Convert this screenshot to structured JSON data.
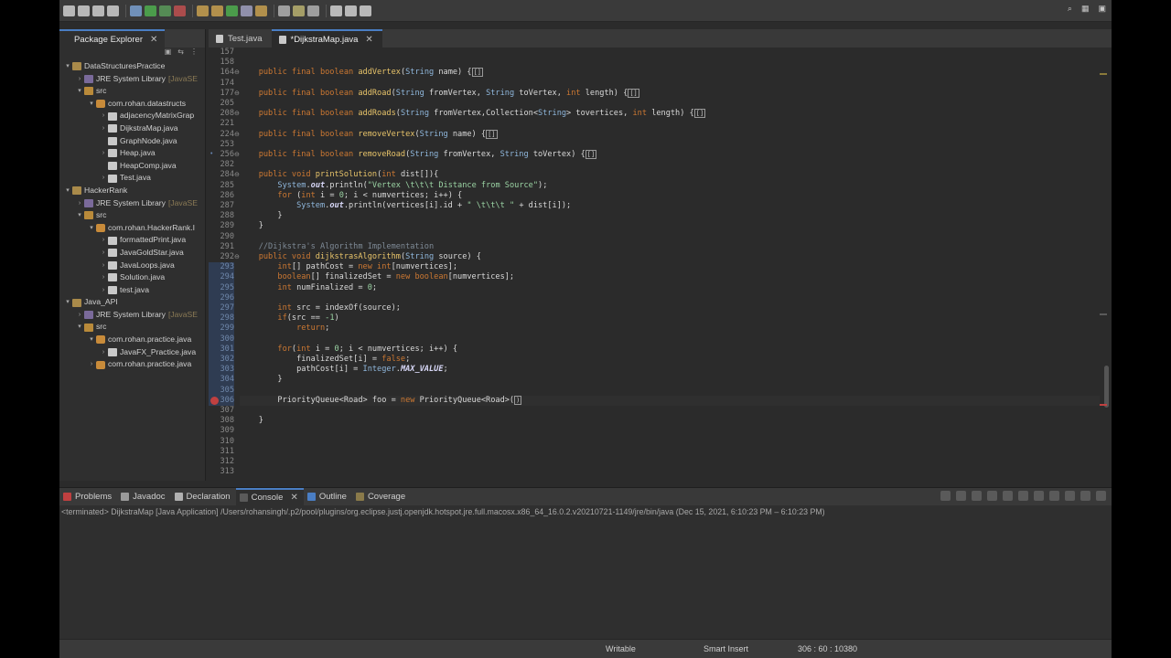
{
  "colors": {
    "accent": "#4a7ec4",
    "error": "#c04040",
    "editor_bg": "#2b2b2b"
  },
  "toolbar": {
    "icons": [
      "new-icon",
      "save-icon",
      "save-all-icon",
      "print-icon",
      "debug-icon",
      "run-icon",
      "coverage-icon",
      "external-tools-icon",
      "new-java-project-icon",
      "new-package-icon",
      "new-class-icon",
      "open-type-icon",
      "search-icon",
      "toggle-mark-icon",
      "annotation-icon",
      "prev-annotation-icon",
      "back-icon",
      "forward-icon",
      "perspective-icon"
    ],
    "right_icons": [
      "search-icon",
      "java-perspective-icon",
      "debug-perspective-icon"
    ]
  },
  "package_explorer": {
    "title": "Package Explorer",
    "tree": [
      {
        "indent": 0,
        "twisty": "v",
        "icon": "project",
        "label": "DataStructuresPractice"
      },
      {
        "indent": 1,
        "twisty": ">",
        "icon": "lib",
        "label": "JRE System Library",
        "extra": "[JavaSE"
      },
      {
        "indent": 1,
        "twisty": "v",
        "icon": "src",
        "label": "src"
      },
      {
        "indent": 2,
        "twisty": "v",
        "icon": "pkg",
        "label": "com.rohan.datastructs"
      },
      {
        "indent": 3,
        "twisty": ">",
        "icon": "java",
        "label": "adjacencyMatrixGrap"
      },
      {
        "indent": 3,
        "twisty": ">",
        "icon": "java",
        "label": "DijkstraMap.java"
      },
      {
        "indent": 3,
        "twisty": "",
        "icon": "java",
        "label": "GraphNode.java"
      },
      {
        "indent": 3,
        "twisty": ">",
        "icon": "java",
        "label": "Heap.java"
      },
      {
        "indent": 3,
        "twisty": "",
        "icon": "java",
        "label": "HeapComp.java"
      },
      {
        "indent": 3,
        "twisty": ">",
        "icon": "java",
        "label": "Test.java"
      },
      {
        "indent": 0,
        "twisty": "v",
        "icon": "project",
        "label": "HackerRank"
      },
      {
        "indent": 1,
        "twisty": ">",
        "icon": "lib",
        "label": "JRE System Library",
        "extra": "[JavaSE"
      },
      {
        "indent": 1,
        "twisty": "v",
        "icon": "src",
        "label": "src"
      },
      {
        "indent": 2,
        "twisty": "v",
        "icon": "pkg",
        "label": "com.rohan.HackerRank.I"
      },
      {
        "indent": 3,
        "twisty": ">",
        "icon": "java",
        "label": "formattedPrint.java"
      },
      {
        "indent": 3,
        "twisty": ">",
        "icon": "java",
        "label": "JavaGoldStar.java"
      },
      {
        "indent": 3,
        "twisty": ">",
        "icon": "java",
        "label": "JavaLoops.java"
      },
      {
        "indent": 3,
        "twisty": ">",
        "icon": "java",
        "label": "Solution.java"
      },
      {
        "indent": 3,
        "twisty": ">",
        "icon": "java",
        "label": "test.java"
      },
      {
        "indent": 0,
        "twisty": "v",
        "icon": "project",
        "label": "Java_API"
      },
      {
        "indent": 1,
        "twisty": ">",
        "icon": "lib",
        "label": "JRE System Library",
        "extra": "[JavaSE"
      },
      {
        "indent": 1,
        "twisty": "v",
        "icon": "src",
        "label": "src"
      },
      {
        "indent": 2,
        "twisty": "v",
        "icon": "pkg",
        "label": "com.rohan.practice.java"
      },
      {
        "indent": 3,
        "twisty": ">",
        "icon": "java",
        "label": "JavaFX_Practice.java"
      },
      {
        "indent": 2,
        "twisty": ">",
        "icon": "pkg",
        "label": "com.rohan.practice.java"
      }
    ]
  },
  "editor": {
    "tabs": [
      {
        "label": "Test.java",
        "active": false
      },
      {
        "label": "*DijkstraMap.java",
        "active": true
      }
    ],
    "lines": [
      {
        "n": "157",
        "segs": []
      },
      {
        "n": "158",
        "segs": []
      },
      {
        "n": "164",
        "fold": true,
        "segs": [
          [
            "kw",
            "    public final boolean "
          ],
          [
            "fn",
            "addVertex"
          ],
          [
            "pl",
            "("
          ],
          [
            "ty",
            "String"
          ],
          [
            "pl",
            " name) {"
          ],
          [
            "box",
            "[]"
          ]
        ]
      },
      {
        "n": "174",
        "segs": []
      },
      {
        "n": "177",
        "fold": true,
        "segs": [
          [
            "kw",
            "    public final boolean "
          ],
          [
            "fn",
            "addRoad"
          ],
          [
            "pl",
            "("
          ],
          [
            "ty",
            "String"
          ],
          [
            "pl",
            " fromVertex, "
          ],
          [
            "ty",
            "String"
          ],
          [
            "pl",
            " toVertex, "
          ],
          [
            "kw",
            "int"
          ],
          [
            "pl",
            " length) {"
          ],
          [
            "box",
            "[]"
          ]
        ]
      },
      {
        "n": "205",
        "segs": []
      },
      {
        "n": "208",
        "fold": true,
        "segs": [
          [
            "kw",
            "    public final boolean "
          ],
          [
            "fn",
            "addRoads"
          ],
          [
            "pl",
            "("
          ],
          [
            "ty",
            "String"
          ],
          [
            "pl",
            " fromVertex,Collection<"
          ],
          [
            "ty",
            "String"
          ],
          [
            "pl",
            "> tovertices, "
          ],
          [
            "kw",
            "int"
          ],
          [
            "pl",
            " length) {"
          ],
          [
            "box",
            "[]"
          ]
        ]
      },
      {
        "n": "221",
        "segs": []
      },
      {
        "n": "224",
        "fold": true,
        "segs": [
          [
            "kw",
            "    public final boolean "
          ],
          [
            "fn",
            "removeVertex"
          ],
          [
            "pl",
            "("
          ],
          [
            "ty",
            "String"
          ],
          [
            "pl",
            " name) {"
          ],
          [
            "box",
            "[]"
          ]
        ]
      },
      {
        "n": "253",
        "segs": []
      },
      {
        "n": "256",
        "fold": true,
        "dot": true,
        "segs": [
          [
            "kw",
            "    public final boolean "
          ],
          [
            "fn",
            "removeRoad"
          ],
          [
            "pl",
            "("
          ],
          [
            "ty",
            "String"
          ],
          [
            "pl",
            " fromVertex, "
          ],
          [
            "ty",
            "String"
          ],
          [
            "pl",
            " toVertex) {"
          ],
          [
            "box",
            "[]"
          ]
        ]
      },
      {
        "n": "282",
        "segs": []
      },
      {
        "n": "284",
        "fold": true,
        "segs": [
          [
            "kw",
            "    public void "
          ],
          [
            "fn",
            "printSolution"
          ],
          [
            "pl",
            "("
          ],
          [
            "kw",
            "int"
          ],
          [
            "pl",
            " dist[]){"
          ]
        ]
      },
      {
        "n": "285",
        "segs": [
          [
            "pl",
            "        "
          ],
          [
            "ty",
            "System"
          ],
          [
            "pl",
            "."
          ],
          [
            "bi",
            "out"
          ],
          [
            "pl",
            ".println("
          ],
          [
            "st",
            "\"Vertex \\t\\t\\t Distance from Source\""
          ],
          [
            "pl",
            ");"
          ]
        ]
      },
      {
        "n": "286",
        "segs": [
          [
            "kw",
            "        for"
          ],
          [
            "pl",
            " ("
          ],
          [
            "kw",
            "int"
          ],
          [
            "pl",
            " i = "
          ],
          [
            "st",
            "0"
          ],
          [
            "pl",
            "; i < numvertices; i++) {"
          ]
        ]
      },
      {
        "n": "287",
        "segs": [
          [
            "pl",
            "            "
          ],
          [
            "ty",
            "System"
          ],
          [
            "pl",
            "."
          ],
          [
            "bi",
            "out"
          ],
          [
            "pl",
            ".println(vertices[i].id + "
          ],
          [
            "st",
            "\" \\t\\t\\t \""
          ],
          [
            "pl",
            " + dist[i]);"
          ]
        ]
      },
      {
        "n": "288",
        "segs": [
          [
            "pl",
            "        }"
          ]
        ]
      },
      {
        "n": "289",
        "segs": [
          [
            "pl",
            "    }"
          ]
        ]
      },
      {
        "n": "290",
        "segs": []
      },
      {
        "n": "291",
        "segs": [
          [
            "cm",
            "    //Dijkstra's Algorithm Implementation"
          ]
        ]
      },
      {
        "n": "292",
        "fold": true,
        "segs": [
          [
            "kw",
            "    public void "
          ],
          [
            "fn",
            "dijkstrasAlgorithm"
          ],
          [
            "pl",
            "("
          ],
          [
            "ty",
            "String"
          ],
          [
            "pl",
            " source) {"
          ]
        ]
      },
      {
        "n": "293",
        "sel": true,
        "segs": [
          [
            "kw",
            "        int"
          ],
          [
            "pl",
            "[] pathCost = "
          ],
          [
            "kw",
            "new int"
          ],
          [
            "pl",
            "[numvertices];"
          ]
        ]
      },
      {
        "n": "294",
        "sel": true,
        "segs": [
          [
            "kw",
            "        boolean"
          ],
          [
            "pl",
            "[] finalizedSet = "
          ],
          [
            "kw",
            "new boolean"
          ],
          [
            "pl",
            "[numvertices];"
          ]
        ]
      },
      {
        "n": "295",
        "sel": true,
        "segs": [
          [
            "kw",
            "        int"
          ],
          [
            "pl",
            " numFinalized = "
          ],
          [
            "st",
            "0"
          ],
          [
            "pl",
            ";"
          ]
        ]
      },
      {
        "n": "296",
        "sel": true,
        "segs": []
      },
      {
        "n": "297",
        "sel": true,
        "segs": [
          [
            "kw",
            "        int"
          ],
          [
            "pl",
            " src = indexOf(source);"
          ]
        ]
      },
      {
        "n": "298",
        "sel": true,
        "segs": [
          [
            "kw",
            "        if"
          ],
          [
            "pl",
            "(src == "
          ],
          [
            "st",
            "-1"
          ],
          [
            "pl",
            ")"
          ]
        ]
      },
      {
        "n": "299",
        "sel": true,
        "segs": [
          [
            "kw",
            "            return"
          ],
          [
            "pl",
            ";"
          ]
        ]
      },
      {
        "n": "300",
        "sel": true,
        "segs": []
      },
      {
        "n": "301",
        "sel": true,
        "segs": [
          [
            "kw",
            "        for"
          ],
          [
            "pl",
            "("
          ],
          [
            "kw",
            "int"
          ],
          [
            "pl",
            " i = "
          ],
          [
            "st",
            "0"
          ],
          [
            "pl",
            "; i < numvertices; i++) {"
          ]
        ]
      },
      {
        "n": "302",
        "sel": true,
        "segs": [
          [
            "pl",
            "            finalizedSet[i] = "
          ],
          [
            "kw",
            "false"
          ],
          [
            "pl",
            ";"
          ]
        ]
      },
      {
        "n": "303",
        "sel": true,
        "segs": [
          [
            "pl",
            "            pathCost[i] = "
          ],
          [
            "ty",
            "Integer"
          ],
          [
            "pl",
            "."
          ],
          [
            "bi",
            "MAX_VALUE"
          ],
          [
            "pl",
            ";"
          ]
        ]
      },
      {
        "n": "304",
        "sel": true,
        "segs": [
          [
            "pl",
            "        }"
          ]
        ]
      },
      {
        "n": "305",
        "sel": true,
        "segs": []
      },
      {
        "n": "306",
        "sel": true,
        "err": true,
        "cur": true,
        "segs": [
          [
            "pl",
            "        PriorityQueue<Road> foo = "
          ],
          [
            "kw",
            "new"
          ],
          [
            "pl",
            " PriorityQueue<Road>("
          ],
          [
            "box",
            ")"
          ]
        ]
      },
      {
        "n": "307",
        "segs": []
      },
      {
        "n": "308",
        "segs": [
          [
            "pl",
            "    }"
          ]
        ]
      },
      {
        "n": "309",
        "segs": []
      },
      {
        "n": "310",
        "segs": []
      },
      {
        "n": "311",
        "segs": []
      },
      {
        "n": "312",
        "segs": []
      },
      {
        "n": "313",
        "segs": []
      }
    ]
  },
  "console": {
    "tabs": [
      {
        "label": "Problems",
        "icon": "problems-icon",
        "color": "#c04040",
        "active": false
      },
      {
        "label": "Javadoc",
        "icon": "javadoc-icon",
        "color": "#9a9a9a",
        "active": false
      },
      {
        "label": "Declaration",
        "icon": "declaration-icon",
        "color": "#b0b0b0",
        "active": false
      },
      {
        "label": "Console",
        "icon": "console-icon",
        "color": "#5a5a5a",
        "active": true
      },
      {
        "label": "Outline",
        "icon": "outline-icon",
        "color": "#4a7ec4",
        "active": false
      },
      {
        "label": "Coverage",
        "icon": "coverage-icon",
        "color": "#8a7a4a",
        "active": false
      }
    ],
    "output": "<terminated> DijkstraMap [Java Application] /Users/rohansingh/.p2/pool/plugins/org.eclipse.justj.openjdk.hotspot.jre.full.macosx.x86_64_16.0.2.v20210721-1149/jre/bin/java  (Dec 15, 2021, 6:10:23 PM – 6:10:23 PM)"
  },
  "status": {
    "mode": "Writable",
    "insert": "Smart Insert",
    "position": "306 : 60 : 10380"
  }
}
